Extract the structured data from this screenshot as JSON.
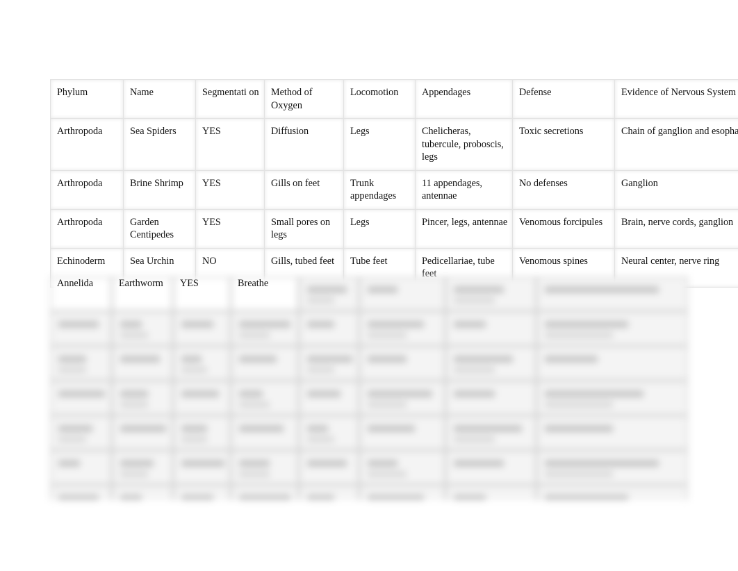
{
  "table": {
    "headers": [
      "Phylum",
      "Name",
      "Segmentati on",
      "Method of Oxygen",
      "Locomotion",
      "Appendages",
      "Defense",
      "Evidence of Nervous System"
    ],
    "rows": [
      [
        "Arthropoda",
        "Sea Spiders",
        "YES",
        "Diffusion",
        "Legs",
        "Chelicheras, tubercule, proboscis, legs",
        "Toxic secretions",
        "Chain of ganglion and esophagus"
      ],
      [
        "Arthropoda",
        "Brine Shrimp",
        "YES",
        "Gills on feet",
        "Trunk appendages",
        "11 appendages, antennae",
        "No defenses",
        "Ganglion"
      ],
      [
        "Arthropoda",
        "Garden Centipedes",
        "YES",
        "Small pores on legs",
        "Legs",
        "Pincer, legs, antennae",
        "Venomous forcipules",
        "Brain, nerve cords, ganglion"
      ],
      [
        "Echinoderm",
        "Sea Urchin",
        "NO",
        "Gills, tubed feet",
        "Tube feet",
        "Pedicellariae, tube feet",
        "Venomous spines",
        "Neural center, nerve ring"
      ]
    ],
    "partial_row": [
      "Annelida",
      "Earthworm",
      "YES",
      "Breathe"
    ],
    "blurred_rows_count": 7
  }
}
